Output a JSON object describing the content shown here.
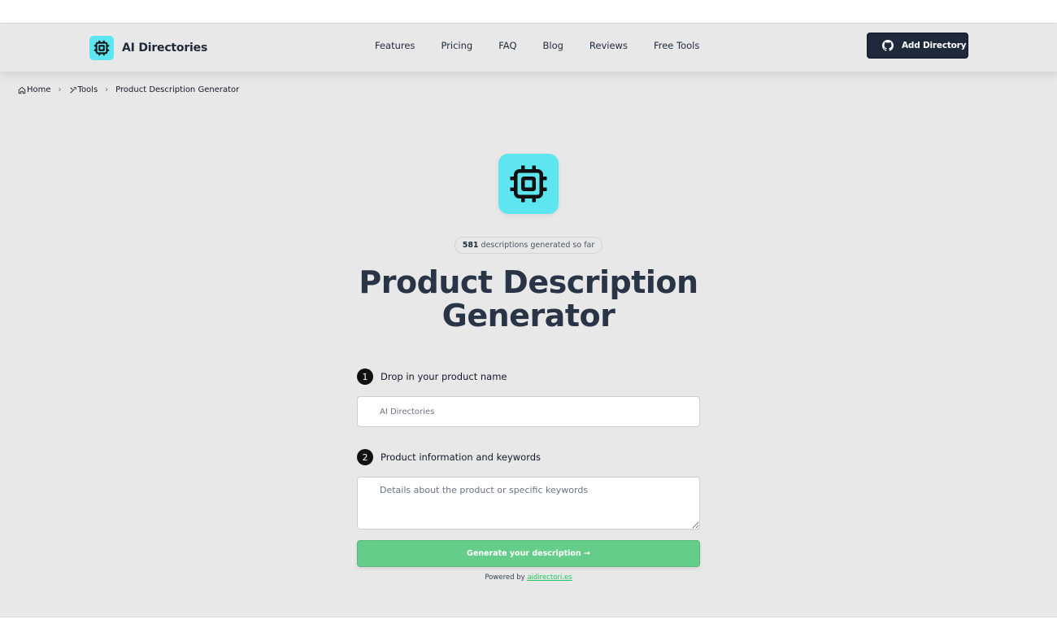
{
  "header": {
    "logo_text": "AI Directories",
    "nav": [
      "Features",
      "Pricing",
      "FAQ",
      "Blog",
      "Reviews",
      "Free Tools"
    ],
    "add_button_label": "Add Directory"
  },
  "breadcrumb": {
    "home": "Home",
    "tools": "Tools",
    "current": "Product Description Generator",
    "separator": "›"
  },
  "hero": {
    "count": "581",
    "count_suffix": "descriptions generated so far",
    "title_line1": "Product Description",
    "title_line2": "Generator"
  },
  "form": {
    "step1_number": "1",
    "step1_label": "Drop in your product name",
    "product_placeholder": "AI Directories",
    "step2_number": "2",
    "step2_label": "Product information and keywords",
    "details_placeholder": "Details about the product or specific keywords",
    "generate_label": "Generate your description →",
    "powered_prefix": "Powered by",
    "powered_link": "aidirectori.es"
  },
  "colors": {
    "accent_cyan": "#5ee6f0",
    "dark_button": "#1e293b",
    "generate_green": "#65cd8a",
    "link_green": "#22c55e",
    "background": "#e8e8e8"
  },
  "icons": [
    "chip-icon",
    "github-icon",
    "home-icon",
    "tools-icon"
  ]
}
